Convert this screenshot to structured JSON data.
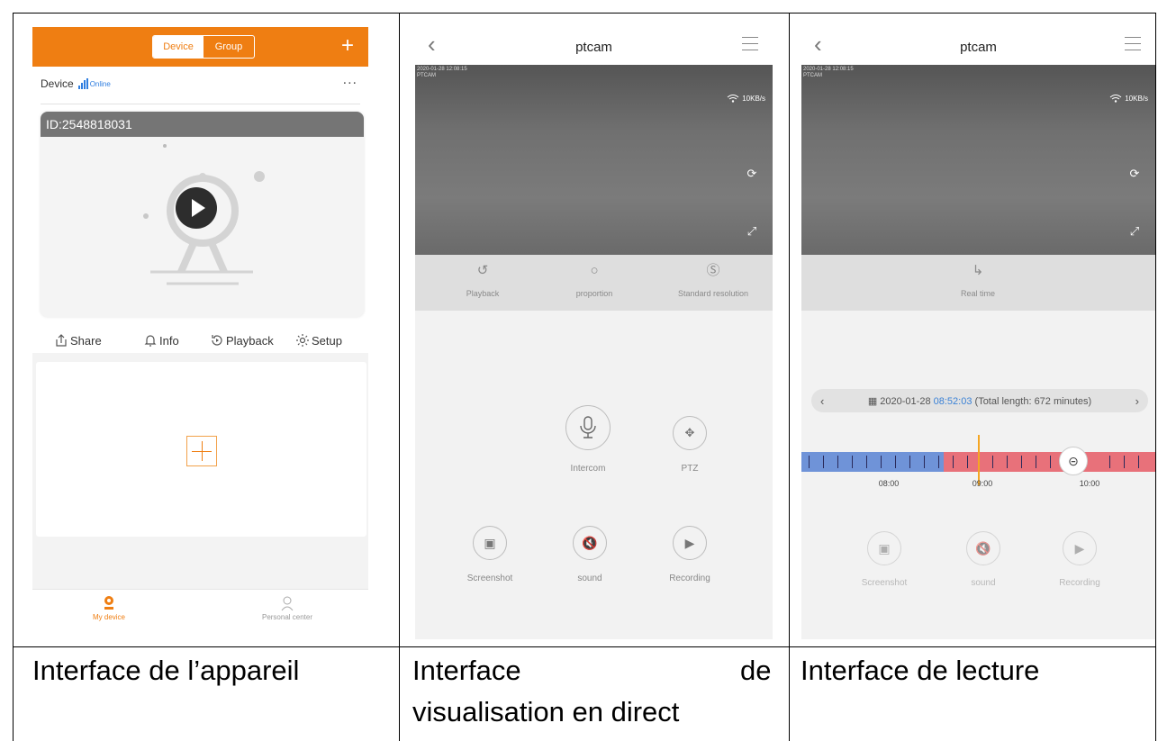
{
  "panel1": {
    "tabs": {
      "device": "Device",
      "group": "Group"
    },
    "plus": "+",
    "device_row": {
      "name": "Device",
      "status": "Online",
      "more": "..."
    },
    "card_id": "ID:2548818031",
    "actions": [
      {
        "icon": "share-icon",
        "label": "Share"
      },
      {
        "icon": "bell-icon",
        "label": "Info"
      },
      {
        "icon": "playback-icon",
        "label": "Playback"
      },
      {
        "icon": "gear-icon",
        "label": "Setup"
      }
    ],
    "nav": [
      {
        "icon": "camera-icon",
        "label": "My device"
      },
      {
        "icon": "user-icon",
        "label": "Personal center"
      }
    ],
    "colors": {
      "accent": "#ef7e12",
      "status": "#2f7ee0"
    }
  },
  "panel2": {
    "title": "ptcam",
    "osd": [
      "2020-01-28 12:08:15",
      "PTCAM"
    ],
    "speed": "10KB/s",
    "tools": [
      {
        "icon": "playback-icon",
        "label": "Playback"
      },
      {
        "icon": "proportion-icon",
        "label": "proportion"
      },
      {
        "icon": "sd-icon",
        "label": "Standard resolution"
      }
    ],
    "controls": {
      "intercom": "Intercom",
      "ptz": "PTZ",
      "screenshot": "Screenshot",
      "sound": "sound",
      "recording": "Recording"
    }
  },
  "panel3": {
    "title": "ptcam",
    "osd": [
      "2020-01-28 12:08:15",
      "PTCAM"
    ],
    "speed": "10KB/s",
    "realtime": "Real time",
    "date": "2020-01-28",
    "time": "08:52:03",
    "total": "(Total length: 672 minutes)",
    "times": [
      "08:00",
      "09:00",
      "10:00"
    ],
    "controls": {
      "screenshot": "Screenshot",
      "sound": "sound",
      "recording": "Recording"
    }
  },
  "captions": {
    "c1": "Interface de l’appareil",
    "c2a": "Interface",
    "c2b": "de",
    "c2c": "visualisation en direct",
    "c3": "Interface de lecture"
  }
}
